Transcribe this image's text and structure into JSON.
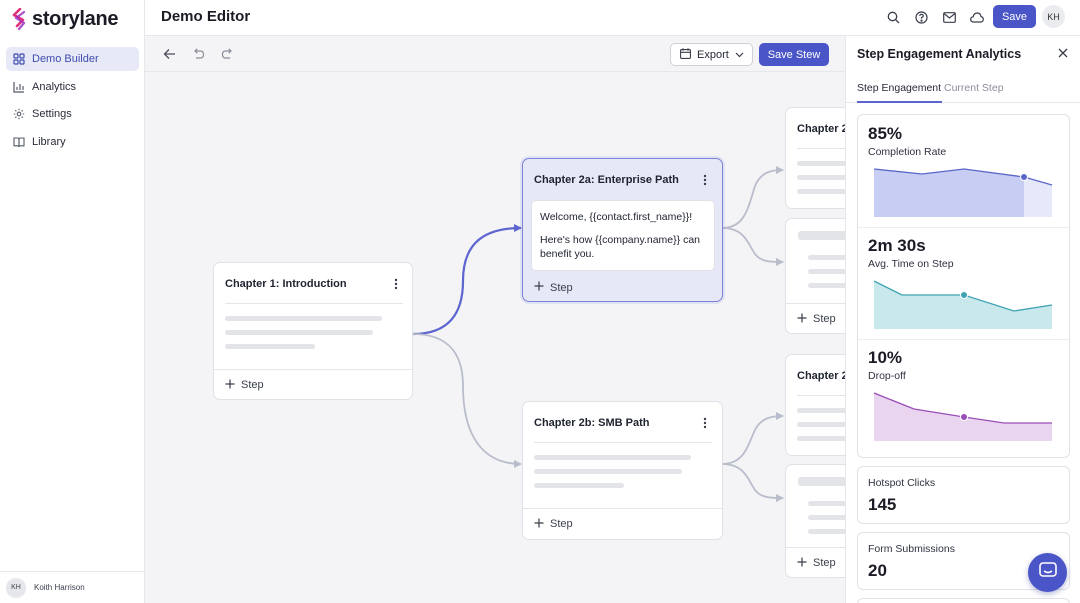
{
  "brand": {
    "name": "storylane",
    "accent": "#4a55c7",
    "logo_color": "#e0307a"
  },
  "sidebar": {
    "items": [
      {
        "label": "Demo Builder",
        "icon": "grid-icon",
        "active": true
      },
      {
        "label": "Analytics",
        "icon": "bar-chart-icon"
      },
      {
        "label": "Settings",
        "icon": "gear-icon"
      },
      {
        "label": "Library",
        "icon": "book-icon"
      }
    ],
    "user": {
      "initials": "KH",
      "name": "Koith Harrison"
    }
  },
  "header": {
    "title": "Demo Editor",
    "save_label": "Save",
    "avatar_initials": "KH",
    "icons": [
      "search-icon",
      "help-icon",
      "mail-icon",
      "cloud-icon"
    ]
  },
  "toolbar": {
    "export_label": "Export",
    "save_stew_label": "Save Stew",
    "icons": [
      "back-arrow-icon",
      "undo-icon",
      "redo-icon"
    ]
  },
  "canvas": {
    "intro": {
      "title": "Chapter 1: Introduction",
      "step_label": "Step"
    },
    "enterprise": {
      "title": "Chapter 2a: Enterprise Path",
      "message_line1": "Welcome, {{contact.first_name}}!",
      "message_line2": "Here's how {{company.name}} can benefit you.",
      "step_label": "Step"
    },
    "smb": {
      "title": "Chapter 2b: SMB Path",
      "step_label": "Step"
    },
    "right_top": {
      "title": "Chapter 2",
      "step_label": "Step"
    },
    "right_bottom": {
      "title": "Chapter 2",
      "step_label": "Step"
    }
  },
  "panel": {
    "title": "Step Engagement Analytics",
    "tabs": [
      {
        "label": "Step Engagement",
        "active": true
      },
      {
        "label": "Current Step",
        "active": false
      }
    ],
    "metrics": [
      {
        "value": "85%",
        "label": "Completion Rate",
        "color": "#5a67c9"
      },
      {
        "value": "2m 30s",
        "label": "Avg. Time on Step",
        "color": "#3ea3b3"
      },
      {
        "value": "10%",
        "label": "Drop-off",
        "color": "#9a4fb8"
      }
    ],
    "stats": [
      {
        "label": "Hotspot Clicks",
        "value": "145"
      },
      {
        "label": "Form Submissions",
        "value": "20"
      }
    ]
  }
}
